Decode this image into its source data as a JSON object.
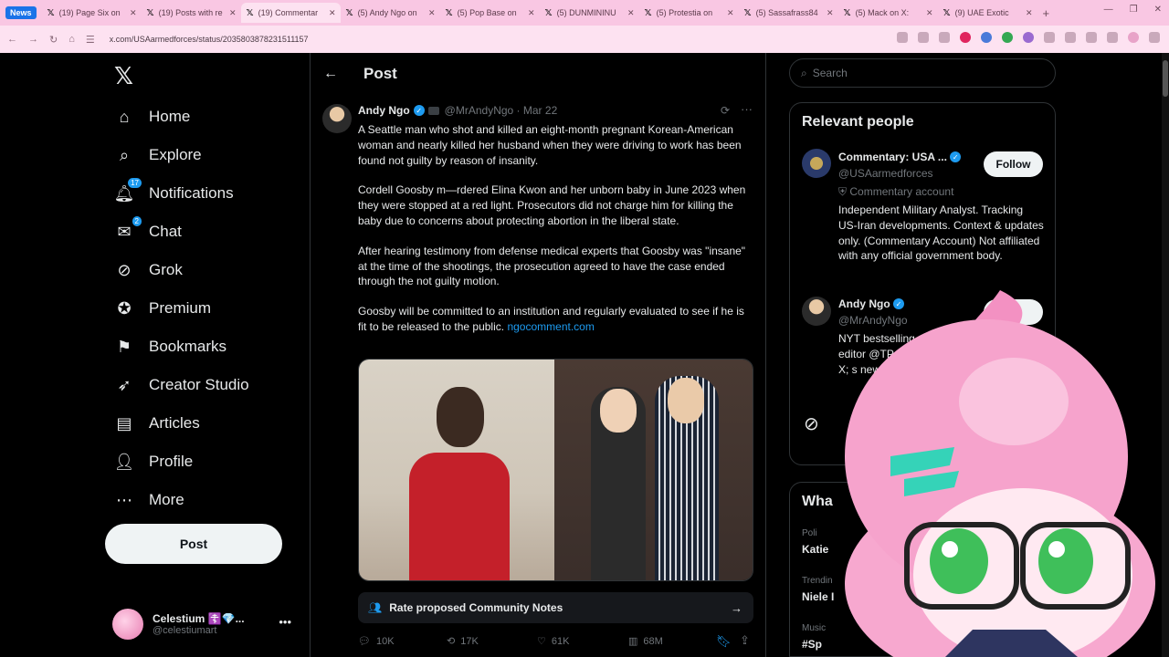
{
  "browser": {
    "news_label": "News",
    "tabs": [
      {
        "title": "(19) Page Six on"
      },
      {
        "title": "(19) Posts with re"
      },
      {
        "title": "(19) Commentar"
      },
      {
        "title": "(5) Andy Ngo on"
      },
      {
        "title": "(5) Pop Base on"
      },
      {
        "title": "(5) DUNMININU"
      },
      {
        "title": "(5) Protestia on"
      },
      {
        "title": "(5) Sassafrass84"
      },
      {
        "title": "(5) Mack on X:"
      },
      {
        "title": "(9) UAE Exotic"
      }
    ],
    "url": "x.com/USAarmedforces/status/2035803878231511157"
  },
  "nav": {
    "items": [
      {
        "label": "Home",
        "icon": "home-icon"
      },
      {
        "label": "Explore",
        "icon": "search-icon"
      },
      {
        "label": "Notifications",
        "icon": "bell-icon",
        "badge": "17"
      },
      {
        "label": "Chat",
        "icon": "mail-icon",
        "badge": "2"
      },
      {
        "label": "Grok",
        "icon": "grok-icon"
      },
      {
        "label": "Premium",
        "icon": "premium-icon"
      },
      {
        "label": "Bookmarks",
        "icon": "bookmark-icon"
      },
      {
        "label": "Creator Studio",
        "icon": "rocket-icon"
      },
      {
        "label": "Articles",
        "icon": "article-icon"
      },
      {
        "label": "Profile",
        "icon": "person-icon"
      },
      {
        "label": "More",
        "icon": "more-circle-icon"
      }
    ],
    "post_button": "Post",
    "account": {
      "name": "Celestium ☦️💎...",
      "handle": "@celestiumart"
    }
  },
  "main": {
    "header_title": "Post",
    "post": {
      "author_name": "Andy Ngo",
      "author_handle": "@MrAndyNgo",
      "date": "Mar 22",
      "paragraphs": [
        "A Seattle man who shot and killed an eight-month pregnant Korean-American woman and nearly killed her husband when they were driving to work has been found not guilty by reason of insanity.",
        "Cordell Goosby m—rdered Elina Kwon and her unborn baby in June 2023 when they were stopped at a red light. Prosecutors did not charge him for killing the baby due to concerns about protecting abortion in the liberal state.",
        "After hearing testimony from defense medical experts that Goosby was \"insane\" at the time of the shootings, the prosecution agreed to have the case ended through the not guilty motion.",
        "Goosby will be committed to an institution and regularly evaluated to see if he is fit to be released to the public."
      ],
      "link": "ngocomment.com",
      "community_notes_label": "Rate proposed Community Notes",
      "replies": "10K",
      "reposts": "17K",
      "likes": "61K",
      "views": "68M"
    }
  },
  "right": {
    "search_placeholder": "Search",
    "relevant_title": "Relevant people",
    "people": [
      {
        "name": "Commentary: USA ...",
        "handle": "@USAarmedforces",
        "label": "Commentary account",
        "bio": "Independent Military Analyst. Tracking US-Iran developments. Context & updates only. (Commentary Account) Not affiliated with any official government body.",
        "follow_label": "Follow"
      },
      {
        "name": "Andy Ngo",
        "handle": "@MrAndyNgo",
        "bio": "NYT bestselling editor @TP my X; s new",
        "follow_label": "F"
      }
    ],
    "whats_title": "Wha",
    "trends": [
      {
        "category": "Poli",
        "name": "Katie"
      },
      {
        "category": "Trendin",
        "name": "Niele I"
      },
      {
        "category": "Music",
        "name": "#Sp"
      }
    ]
  },
  "colors": {
    "accent": "#1d9bf0",
    "background": "#000000",
    "tabbar": "#f9c7e3",
    "addrbar": "#fde2f1"
  }
}
